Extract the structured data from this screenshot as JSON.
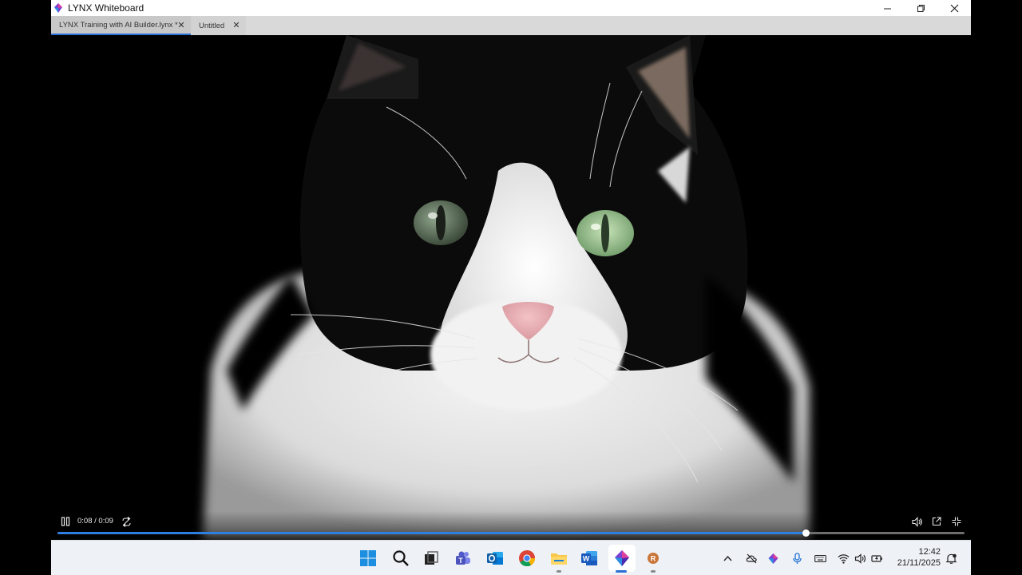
{
  "app": {
    "title": "LYNX Whiteboard",
    "accent_color": "#2a6fd6"
  },
  "tabs": [
    {
      "label": "LYNX Training with AI Builder.lynx *",
      "active": true,
      "close_icon": "close-icon"
    },
    {
      "label": "Untitled",
      "active": false,
      "close_icon": "close-icon"
    }
  ],
  "window_controls": [
    "minimize-icon",
    "maximize-icon",
    "close-icon"
  ],
  "video": {
    "subject": "cat-photo",
    "current_time": "0:08",
    "duration": "0:09",
    "time_display": "0:08 / 0:09",
    "progress_fraction": 0.825,
    "progress_color": "#2f7fe0",
    "controls": [
      "pause-icon",
      "loop-icon",
      "volume-icon",
      "popout-icon",
      "exit-fullscreen-icon"
    ]
  },
  "taskbar": {
    "apps": [
      "windows-start-icon",
      "search-icon",
      "task-view-icon",
      "teams-icon",
      "outlook-icon",
      "chrome-icon",
      "file-explorer-icon",
      "word-icon",
      "lynx-app-icon",
      "r-app-icon"
    ],
    "active_app": "lynx-app-icon",
    "tray_icons": [
      "chevron-up-icon",
      "cloud-off-icon",
      "lynx-tray-icon",
      "microphone-icon",
      "keyboard-icon",
      "wifi-icon",
      "speaker-icon",
      "battery-icon"
    ],
    "clock": {
      "time": "12:42",
      "date": "21/11/2025"
    },
    "notification_icon": "notification-bell-icon"
  }
}
